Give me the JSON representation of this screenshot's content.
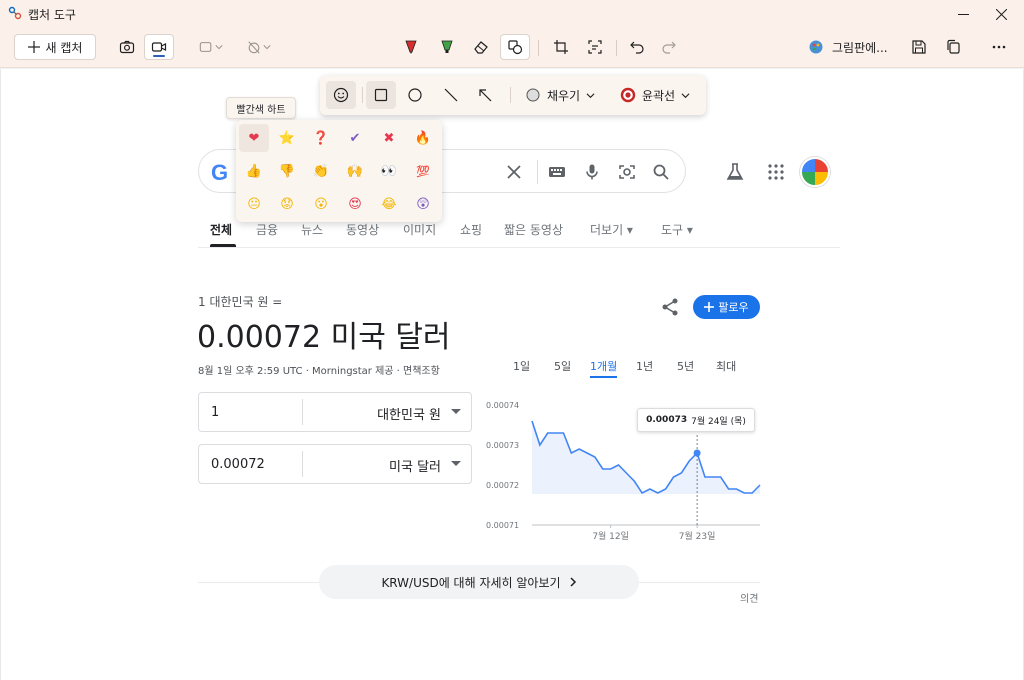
{
  "window": {
    "title": "캡처 도구"
  },
  "toolbar": {
    "new_capture_label": "새 캡처",
    "open_in_label": "그림판에..."
  },
  "shape_toolbar": {
    "fill_label": "채우기",
    "outline_label": "윤곽선",
    "outline_color": "#c62828"
  },
  "emoji_picker": {
    "tooltip": "빨간색 하트",
    "emojis": [
      "❤",
      "⭐",
      "❓",
      "✔",
      "✖",
      "🔥",
      "👍",
      "👎",
      "👏",
      "🙌",
      "👀",
      "💯",
      "😐",
      "😟",
      "😮",
      "😍",
      "😂",
      "😲"
    ]
  },
  "google": {
    "tabs": [
      "전체",
      "금융",
      "뉴스",
      "동영상",
      "이미지",
      "쇼핑",
      "짧은 동영상",
      "더보기 ▾",
      "도구 ▾"
    ],
    "active_tab": "전체",
    "accent_color": "#1a73e8"
  },
  "converter": {
    "subtitle": "1 대한민국 원 =",
    "result": "0.00072 미국 달러",
    "timestamp": "8월 1일 오후 2:59 UTC · Morningstar 제공 · 면책조항",
    "follow_label": "팔로우",
    "from_value": "1",
    "from_currency": "대한민국 원",
    "to_value": "0.00072",
    "to_currency": "미국 달러",
    "ranges": [
      "1일",
      "5일",
      "1개월",
      "1년",
      "5년",
      "최대"
    ],
    "active_range": "1개월"
  },
  "chart_data": {
    "type": "line",
    "ylim": [
      0.00071,
      0.00074
    ],
    "yticks": [
      "0.00074",
      "0.00073",
      "0.00072",
      "0.00071"
    ],
    "xticks": [
      "7월 12일",
      "7월 23일"
    ],
    "values": [
      0.000736,
      0.00073,
      0.000733,
      0.000733,
      0.000733,
      0.000728,
      0.000729,
      0.000728,
      0.000727,
      0.000724,
      0.000724,
      0.000725,
      0.000723,
      0.000721,
      0.000718,
      0.000719,
      0.000718,
      0.000719,
      0.000722,
      0.000723,
      0.000726,
      0.000728,
      0.000722,
      0.000722,
      0.000722,
      0.000719,
      0.000719,
      0.000718,
      0.000718,
      0.00072
    ],
    "tooltip_value": "0.00073",
    "tooltip_date": "7월 24일 (목)",
    "highlight_index": 21
  },
  "footer": {
    "learn_more": "KRW/USD에 대해 자세히 알아보기",
    "feedback": "의견"
  }
}
